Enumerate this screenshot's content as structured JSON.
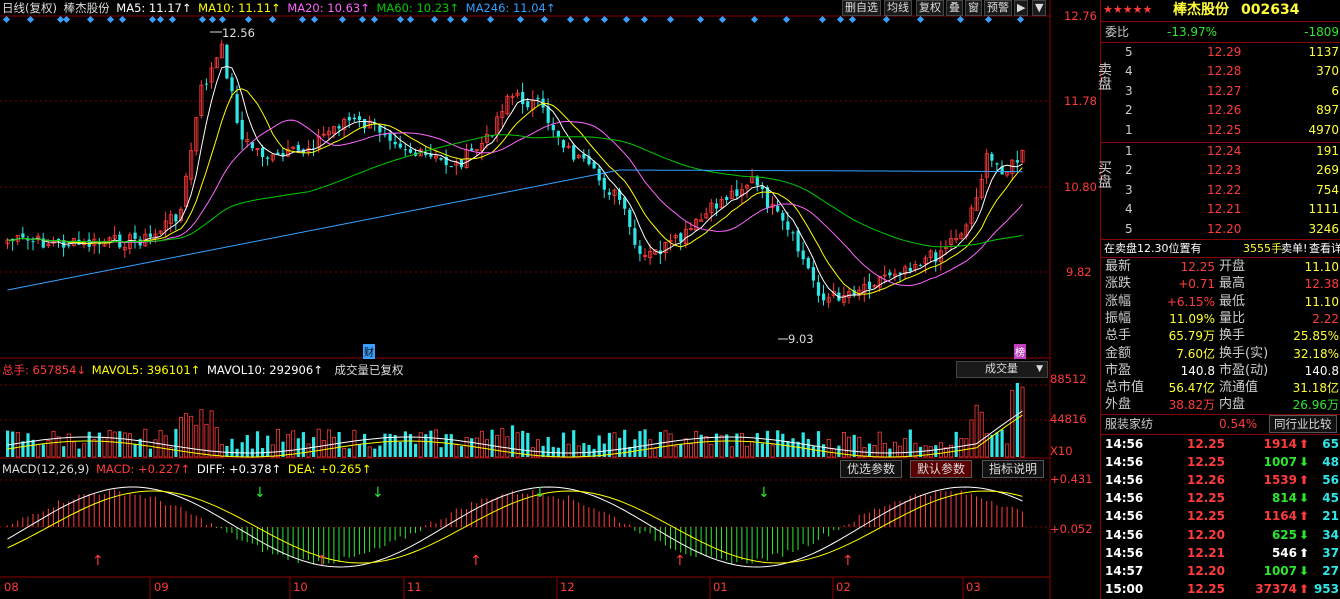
{
  "main_legend": {
    "period": "日线(复权)",
    "name": "棒杰股份",
    "ma5": "MA5: 11.17↑",
    "ma10": "MA10: 11.11↑",
    "ma20": "MA20: 10.63↑",
    "ma60": "MA60: 10.23↑",
    "ma246": "MA246: 11.04↑"
  },
  "toolbar": {
    "delete": "删自选",
    "avg": "均线",
    "restore": "复权",
    "overlay": "叠",
    "window": "窗",
    "warn": "预警"
  },
  "price_axis": [
    "12.76",
    "11.78",
    "10.80",
    "9.82"
  ],
  "price_annotations": {
    "high": "12.56",
    "low": "9.03",
    "fin": "财",
    "bang": "榜"
  },
  "vol_legend": {
    "total": "总手: 657854↓",
    "mavol5": "MAVOL5: 396101↑",
    "mavol10": "MAVOL10: 292906↑",
    "note": "成交量已复权"
  },
  "vol_select": "成交量",
  "vol_axis": [
    "88512",
    "44816",
    "X10"
  ],
  "macd_legend": {
    "name": "MACD(12,26,9)",
    "macd": "MACD: +0.227↑",
    "diff": "DIFF: +0.378↑",
    "dea": "DEA: +0.265↑"
  },
  "macd_buttons": [
    "优选参数",
    "默认参数",
    "指标说明"
  ],
  "macd_axis": [
    "+0.431",
    "+0.052"
  ],
  "x_axis": [
    "08",
    "09",
    "10",
    "11",
    "12",
    "01",
    "02",
    "03"
  ],
  "stock": {
    "stars": "★★★★★",
    "name": "棒杰股份",
    "code": "002634"
  },
  "weibi": {
    "label": "委比",
    "pct": "-13.97%",
    "diff": "-1809"
  },
  "sell_label": "卖盘",
  "buy_label": "买盘",
  "asks": [
    {
      "n": "5",
      "price": "12.29",
      "vol": "1137"
    },
    {
      "n": "4",
      "price": "12.28",
      "vol": "370"
    },
    {
      "n": "3",
      "price": "12.27",
      "vol": "6"
    },
    {
      "n": "2",
      "price": "12.26",
      "vol": "897"
    },
    {
      "n": "1",
      "price": "12.25",
      "vol": "4970"
    }
  ],
  "bids": [
    {
      "n": "1",
      "price": "12.24",
      "vol": "191"
    },
    {
      "n": "2",
      "price": "12.23",
      "vol": "269"
    },
    {
      "n": "3",
      "price": "12.22",
      "vol": "754"
    },
    {
      "n": "4",
      "price": "12.21",
      "vol": "1111"
    },
    {
      "n": "5",
      "price": "12.20",
      "vol": "3246"
    }
  ],
  "ticker_line": {
    "a": "在卖盘12.30位置有",
    "b": "3555手",
    "c": "卖单!",
    "d": "查看详细"
  },
  "quote": [
    {
      "l1": "最新",
      "v1": "12.25",
      "c1": "red",
      "l2": "开盘",
      "v2": "11.10",
      "c2": "yel"
    },
    {
      "l1": "涨跌",
      "v1": "+0.71",
      "c1": "red",
      "l2": "最高",
      "v2": "12.38",
      "c2": "red"
    },
    {
      "l1": "涨幅",
      "v1": "+6.15%",
      "c1": "red",
      "l2": "最低",
      "v2": "11.10",
      "c2": "yel"
    },
    {
      "l1": "振幅",
      "v1": "11.09%",
      "c1": "yel",
      "l2": "量比",
      "v2": "2.22",
      "c2": "red"
    },
    {
      "l1": "总手",
      "v1": "65.79万",
      "c1": "yel",
      "l2": "换手",
      "v2": "25.85%",
      "c2": "yel"
    },
    {
      "l1": "金额",
      "v1": "7.60亿",
      "c1": "yel",
      "l2": "换手(实)",
      "v2": "32.18%",
      "c2": "yel"
    },
    {
      "l1": "市盈",
      "v1": "140.8",
      "c1": "wht",
      "l2": "市盈(动)",
      "v2": "140.8",
      "c2": "wht"
    },
    {
      "l1": "总市值",
      "v1": "56.47亿",
      "c1": "yel",
      "l2": "流通值",
      "v2": "31.18亿",
      "c2": "yel"
    },
    {
      "l1": "外盘",
      "v1": "38.82万",
      "c1": "red",
      "l2": "内盘",
      "v2": "26.96万",
      "c2": "grn"
    }
  ],
  "industry": {
    "name": "服装家纺",
    "pct": "0.54%",
    "compare": "同行业比较"
  },
  "ticks": [
    {
      "t": "14:56",
      "p": "12.25",
      "pc": "red",
      "v": "1914",
      "vc": "red",
      "dir": "up",
      "n": "65"
    },
    {
      "t": "14:56",
      "p": "12.25",
      "pc": "red",
      "v": "1007",
      "vc": "grn",
      "dir": "down",
      "n": "48"
    },
    {
      "t": "14:56",
      "p": "12.26",
      "pc": "red",
      "v": "1539",
      "vc": "red",
      "dir": "up",
      "n": "56"
    },
    {
      "t": "14:56",
      "p": "12.25",
      "pc": "red",
      "v": "814",
      "vc": "grn",
      "dir": "down",
      "n": "45"
    },
    {
      "t": "14:56",
      "p": "12.25",
      "pc": "red",
      "v": "1164",
      "vc": "red",
      "dir": "up",
      "n": "21"
    },
    {
      "t": "14:56",
      "p": "12.20",
      "pc": "red",
      "v": "625",
      "vc": "grn",
      "dir": "down",
      "n": "34"
    },
    {
      "t": "14:56",
      "p": "12.21",
      "pc": "red",
      "v": "546",
      "vc": "wht",
      "dir": "up",
      "n": "37"
    },
    {
      "t": "14:57",
      "p": "12.20",
      "pc": "red",
      "v": "1007",
      "vc": "grn",
      "dir": "down",
      "n": "27"
    },
    {
      "t": "15:00",
      "p": "12.25",
      "pc": "red",
      "v": "37374",
      "vc": "red",
      "dir": "up",
      "n": "953"
    }
  ],
  "colors": {
    "up": "#ff3b3b",
    "down": "#2ee6e6",
    "ma5": "#ffffff",
    "ma10": "#ffff00",
    "ma20": "#ff66ff",
    "ma60": "#00cc00",
    "ma246": "#33a0ff"
  }
}
